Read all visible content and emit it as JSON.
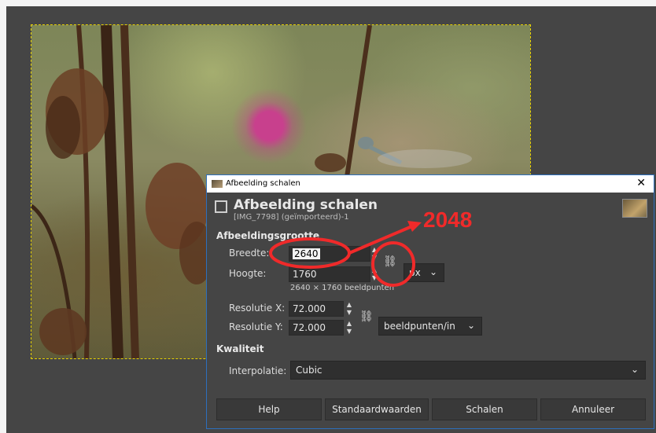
{
  "dialog": {
    "window_title": "Afbeelding schalen",
    "close_glyph": "✕",
    "header_title": "Afbeelding schalen",
    "header_subtitle": "[IMG_7798] (geïmporteerd)-1"
  },
  "image_size": {
    "section": "Afbeeldingsgrootte",
    "width_label": "Breedte:",
    "width_value": "2640",
    "height_label": "Hoogte:",
    "height_value": "1760",
    "unit": "px",
    "pixels_info": "2640 × 1760 beeldpunten",
    "res_x_label": "Resolutie X:",
    "res_x_value": "72.000",
    "res_y_label": "Resolutie Y:",
    "res_y_value": "72.000",
    "res_unit": "beeldpunten/in"
  },
  "quality": {
    "section": "Kwaliteit",
    "interp_label": "Interpolatie:",
    "interp_value": "Cubic"
  },
  "buttons": {
    "help": "Help",
    "defaults": "Standaardwaarden",
    "scale": "Schalen",
    "cancel": "Annuleer"
  },
  "annotation": {
    "text": "2048",
    "color": "#f02a2a"
  },
  "icons": {
    "chain": "chain-link-icon",
    "chevron": "chevron-down-icon",
    "close": "close-icon"
  }
}
